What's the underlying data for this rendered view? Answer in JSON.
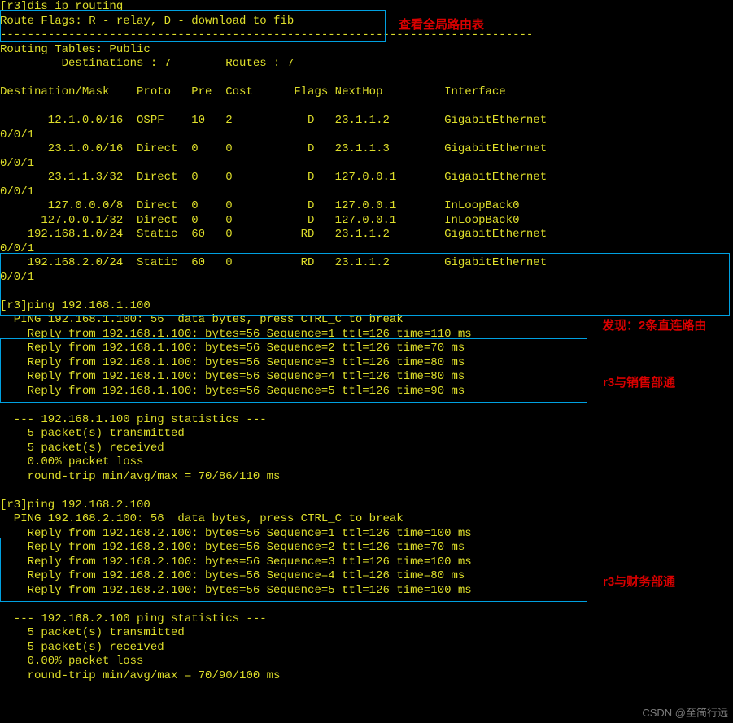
{
  "annotations": {
    "top_label": "查看全局路由表",
    "discover_label": "发现：2条直连路由",
    "sales_label": "r3与销售部通",
    "finance_label": "r3与财务部通"
  },
  "watermark": "CSDN @至简行远",
  "routing": {
    "cmd": "[r3]dis ip routing",
    "flags": "Route Flags: R - relay, D - download to fib",
    "sep": "------------------------------------------------------------------------------",
    "title": "Routing Tables: Public",
    "counts": "         Destinations : 7        Routes : 7",
    "blank": "",
    "header": "Destination/Mask    Proto   Pre  Cost      Flags NextHop         Interface",
    "rows": [
      "       12.1.0.0/16  OSPF    10   2           D   23.1.1.2        GigabitEthernet",
      "0/0/1",
      "       23.1.0.0/16  Direct  0    0           D   23.1.1.3        GigabitEthernet",
      "0/0/1",
      "       23.1.1.3/32  Direct  0    0           D   127.0.0.1       GigabitEthernet",
      "0/0/1",
      "       127.0.0.0/8  Direct  0    0           D   127.0.0.1       InLoopBack0",
      "      127.0.0.1/32  Direct  0    0           D   127.0.0.1       InLoopBack0",
      "    192.168.1.0/24  Static  60   0          RD   23.1.1.2        GigabitEthernet",
      "0/0/1",
      "    192.168.2.0/24  Static  60   0          RD   23.1.1.2        GigabitEthernet",
      "0/0/1"
    ]
  },
  "ping1": {
    "cmd": "[r3]ping 192.168.1.100",
    "head": "  PING 192.168.1.100: 56  data bytes, press CTRL_C to break",
    "r1": "    Reply from 192.168.1.100: bytes=56 Sequence=1 ttl=126 time=110 ms",
    "r2": "    Reply from 192.168.1.100: bytes=56 Sequence=2 ttl=126 time=70 ms",
    "r3": "    Reply from 192.168.1.100: bytes=56 Sequence=3 ttl=126 time=80 ms",
    "r4": "    Reply from 192.168.1.100: bytes=56 Sequence=4 ttl=126 time=80 ms",
    "r5": "    Reply from 192.168.1.100: bytes=56 Sequence=5 ttl=126 time=90 ms",
    "blank": "",
    "s1": "  --- 192.168.1.100 ping statistics ---",
    "s2": "    5 packet(s) transmitted",
    "s3": "    5 packet(s) received",
    "s4": "    0.00% packet loss",
    "s5": "    round-trip min/avg/max = 70/86/110 ms"
  },
  "ping2": {
    "cmd": "[r3]ping 192.168.2.100",
    "head": "  PING 192.168.2.100: 56  data bytes, press CTRL_C to break",
    "r1": "    Reply from 192.168.2.100: bytes=56 Sequence=1 ttl=126 time=100 ms",
    "r2": "    Reply from 192.168.2.100: bytes=56 Sequence=2 ttl=126 time=70 ms",
    "r3": "    Reply from 192.168.2.100: bytes=56 Sequence=3 ttl=126 time=100 ms",
    "r4": "    Reply from 192.168.2.100: bytes=56 Sequence=4 ttl=126 time=80 ms",
    "r5": "    Reply from 192.168.2.100: bytes=56 Sequence=5 ttl=126 time=100 ms",
    "blank": "",
    "s1": "  --- 192.168.2.100 ping statistics ---",
    "s2": "    5 packet(s) transmitted",
    "s3": "    5 packet(s) received",
    "s4": "    0.00% packet loss",
    "s5": "    round-trip min/avg/max = 70/90/100 ms"
  }
}
